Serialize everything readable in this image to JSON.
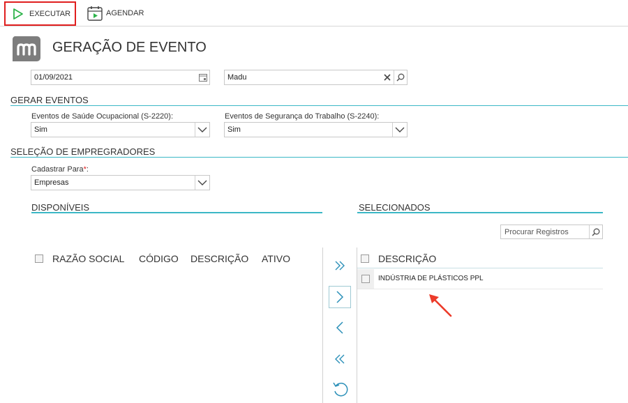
{
  "toolbar": {
    "run_label": "EXECUTAR",
    "schedule_label": "AGENDAR"
  },
  "header": {
    "title": "GERAÇÃO DE EVENTO"
  },
  "filters": {
    "date_value": "01/09/2021",
    "employer_value": "Madu"
  },
  "gerar_eventos": {
    "title": "GERAR EVENTOS",
    "s2220_label": "Eventos de Saúde Ocupacional (S-2220):",
    "s2220_value": "Sim",
    "s2240_label": "Eventos de Segurança do Trabalho (S-2240):",
    "s2240_value": "Sim"
  },
  "selecao": {
    "title": "SELEÇÃO DE EMPREGRADORES",
    "cadastrar_label": "Cadastrar Para",
    "required_mark": "*",
    "label_colon": ":",
    "cadastrar_value": "Empresas"
  },
  "available": {
    "title": "DISPONÍVEIS",
    "columns": [
      "RAZÃO SOCIAL",
      "CÓDIGO",
      "DESCRIÇÃO",
      "ATIVO"
    ]
  },
  "selected": {
    "title": "SELECIONADOS",
    "search_placeholder": "Procurar Registros",
    "column": "DESCRIÇÃO",
    "rows": [
      "INDÚSTRIA DE PLÁSTICOS PPL"
    ]
  },
  "colors": {
    "accent": "#3bb7c6",
    "run_border": "#e01e1e",
    "play_green": "#2db34a",
    "arrow_blue": "#2a8fb8",
    "pointer_red": "#ec3b2a"
  }
}
